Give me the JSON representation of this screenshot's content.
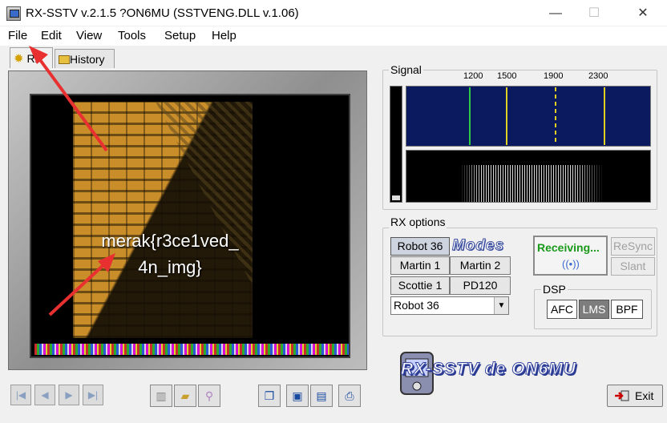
{
  "window": {
    "title": "RX-SSTV v.2.1.5 ?ON6MU (SSTVENG.DLL v.1.06)",
    "controls": {
      "minimize": "—",
      "maximize": "☐",
      "close": "✕"
    }
  },
  "menu": [
    "File",
    "Edit",
    "View",
    "Tools",
    "Setup",
    "Help"
  ],
  "tabs": [
    {
      "label": "RX",
      "icon": "gear-icon",
      "active": true
    },
    {
      "label": "History",
      "icon": "folder-icon",
      "active": false
    }
  ],
  "image": {
    "caption_line1": "merak{r3ce1ved_",
    "caption_line2": "4n_img}"
  },
  "bottom_toolbar": {
    "nav_icons": [
      "first-icon",
      "prev-icon",
      "next-icon",
      "last-icon"
    ],
    "file_icons": [
      "trash-icon",
      "open-folder-icon",
      "zoom-icon"
    ],
    "save_icons": [
      "copy-icon",
      "save-icon",
      "save-as-icon",
      "print-icon"
    ]
  },
  "signal": {
    "label": "Signal",
    "freq_labels": [
      "1200",
      "1500",
      "1900",
      "2300"
    ],
    "colors": {
      "sync": "#2ecc40",
      "data": "#e0d020",
      "spectrum_bg": "#0b1a5e"
    }
  },
  "rx_options": {
    "label": "RX options",
    "mode_buttons": [
      "Robot 36",
      "Martin 1",
      "Martin 2",
      "Scottie 1",
      "PD120"
    ],
    "modes_logo": "Modes",
    "selected_mode": "Robot 36",
    "status": "Receiving...",
    "resync": "ReSync",
    "slant": "Slant"
  },
  "dsp": {
    "label": "DSP",
    "buttons": [
      "AFC",
      "LMS",
      "BPF"
    ],
    "active": "LMS"
  },
  "brand": "RX-SSTV de ON6MU",
  "exit_label": "Exit"
}
